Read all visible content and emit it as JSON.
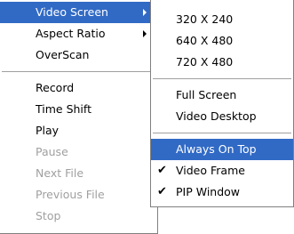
{
  "main_menu": {
    "items": [
      {
        "label": "Video Screen",
        "submenu": true
      },
      {
        "label": "Aspect Ratio",
        "submenu": true
      },
      {
        "label": "OverScan"
      },
      {
        "label": "Record"
      },
      {
        "label": "Time Shift"
      },
      {
        "label": "Play"
      },
      {
        "label": "Pause",
        "disabled": true
      },
      {
        "label": "Next File",
        "disabled": true
      },
      {
        "label": "Previous File",
        "disabled": true
      },
      {
        "label": "Stop",
        "disabled": true
      }
    ]
  },
  "submenu": {
    "items": [
      {
        "label": "320 X 240"
      },
      {
        "label": "640 X 480"
      },
      {
        "label": "720 X 480"
      },
      {
        "label": "Full Screen"
      },
      {
        "label": "Video Desktop"
      },
      {
        "label": "Always On Top"
      },
      {
        "label": "Video Frame",
        "checked": true
      },
      {
        "label": "PIP Window",
        "checked": true
      }
    ]
  },
  "colors": {
    "highlight": "#316ac5",
    "disabled_text": "#a0a0a0"
  },
  "icons": {
    "check": "✔"
  }
}
